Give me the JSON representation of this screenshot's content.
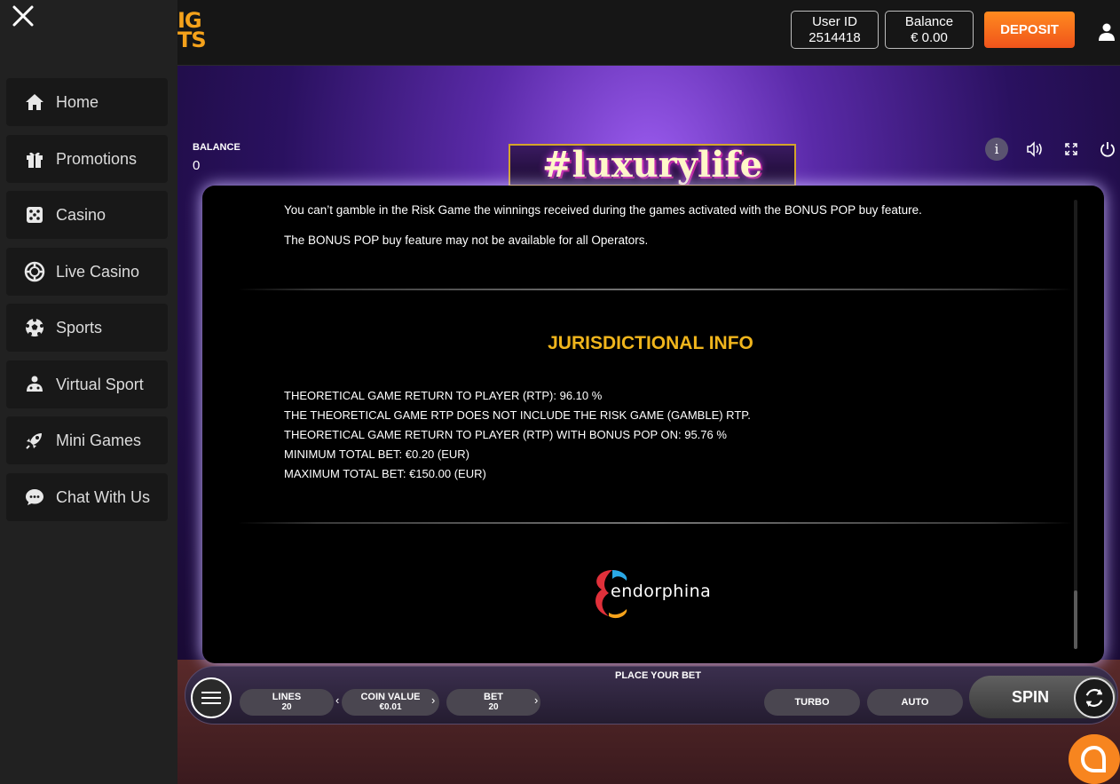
{
  "header": {
    "logo_text": "IG\nTS",
    "user_id_label": "User ID",
    "user_id_value": "2514418",
    "balance_label": "Balance",
    "balance_value": "€ 0.00",
    "deposit_label": "DEPOSIT"
  },
  "sidebar": {
    "items": [
      {
        "label": "Home",
        "icon": "home-icon"
      },
      {
        "label": "Promotions",
        "icon": "gift-icon"
      },
      {
        "label": "Casino",
        "icon": "dice-icon"
      },
      {
        "label": "Live Casino",
        "icon": "chip-icon"
      },
      {
        "label": "Sports",
        "icon": "soccer-ball-icon"
      },
      {
        "label": "Virtual Sport",
        "icon": "gamepad-icon"
      },
      {
        "label": "Mini Games",
        "icon": "rocket-icon"
      },
      {
        "label": "Chat With Us",
        "icon": "chat-icon"
      }
    ]
  },
  "game": {
    "balance_label": "BALANCE",
    "balance_value": "0",
    "title": "#luxurylife",
    "info_icon_label": "i"
  },
  "info_panel": {
    "para1": "You can’t gamble in the Risk Game the winnings received during the games activated with the BONUS POP buy feature.",
    "para2": "The BONUS POP buy feature may not be available for all Operators.",
    "jurisdiction_title": "JURISDICTIONAL INFO",
    "lines": [
      "THEORETICAL GAME RETURN TO PLAYER (RTP): 96.10 %",
      "THE THEORETICAL GAME RTP DOES NOT INCLUDE THE RISK GAME (GAMBLE) RTP.",
      "THEORETICAL GAME RETURN TO PLAYER (RTP) WITH BONUS POP ON: 95.76 %",
      "MINIMUM TOTAL BET: €0.20 (EUR)",
      "MAXIMUM TOTAL BET: €150.00 (EUR)"
    ],
    "provider": "endorphina"
  },
  "controls": {
    "place_bet": "PLACE YOUR BET",
    "lines_label": "LINES",
    "lines_value": "20",
    "coin_label": "COIN VALUE",
    "coin_value": "€0.01",
    "bet_label": "BET",
    "bet_value": "20",
    "turbo_label": "TURBO",
    "auto_label": "AUTO",
    "spin_label": "SPIN",
    "arrow_left": "‹",
    "arrow_right": "›"
  },
  "colors": {
    "accent_orange": "#f7851f",
    "jurisdiction_gold": "#f0b51c",
    "sidebar_bg": "#212121"
  }
}
